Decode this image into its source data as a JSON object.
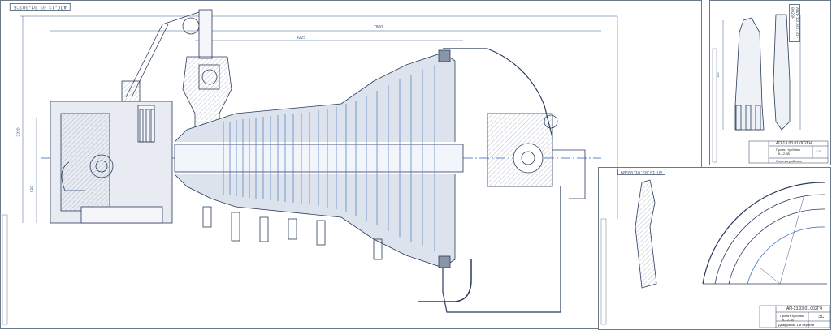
{
  "sheets": {
    "main": {
      "stamp": "АПЛ-13.03.01-002СБ",
      "dimension_overall": "7800",
      "dimension_span": "4225",
      "dimension_height": "2320",
      "dimension_small": "610"
    },
    "blade": {
      "stamp": "АПЛ-13.03.01-002ВЧ",
      "drawing_code": "АП-13.03.01.002ГЧ",
      "title_line1": "Проект турбины",
      "title_line2": "К-12-35",
      "subtitle": "Лопатка рабочая",
      "sheet_no": "1:2",
      "dimension": "182"
    },
    "disk": {
      "stamp": "АП-13.03.01.002ВЧ",
      "drawing_code": "АП-13.03.01.002ГЧ",
      "title_line1": "Проект турбины",
      "title_line2": "К-12-35",
      "subtitle": "Диафрагма 1-й ступени",
      "org": "ТЭС"
    }
  }
}
